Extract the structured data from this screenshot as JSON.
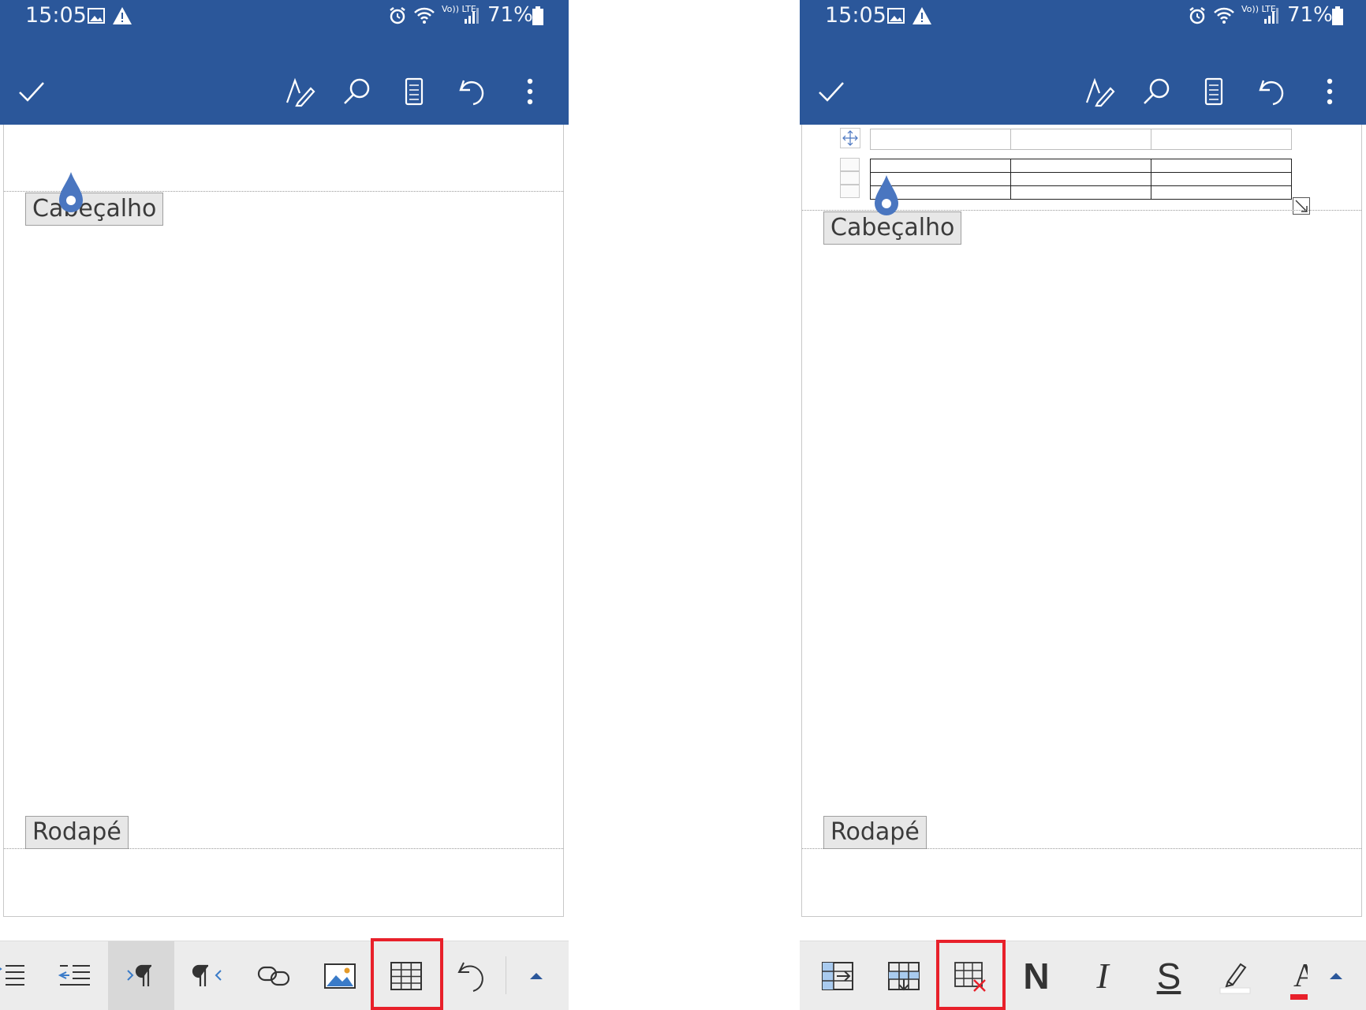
{
  "status_bar": {
    "time": "15:05",
    "network": "Vo)) LTE",
    "battery": "71%"
  },
  "left": {
    "document": {
      "header_label": "Cabeçalho",
      "footer_label": "Rodapé"
    },
    "bottom_toolbar": [
      {
        "name": "bullet-list-icon"
      },
      {
        "name": "decrease-indent-icon"
      },
      {
        "name": "ltr-paragraph-icon",
        "active": true
      },
      {
        "name": "rtl-paragraph-icon"
      },
      {
        "name": "link-icon"
      },
      {
        "name": "picture-icon"
      },
      {
        "name": "table-icon",
        "highlighted": true
      },
      {
        "name": "undo-icon"
      },
      {
        "name": "expand-up-icon"
      }
    ]
  },
  "right": {
    "document": {
      "header_label": "Cabeçalho",
      "footer_label": "Rodapé",
      "table": {
        "rows": 3,
        "cols": 3
      }
    },
    "bottom_toolbar": [
      {
        "name": "insert-column-icon"
      },
      {
        "name": "insert-row-icon"
      },
      {
        "name": "delete-table-icon",
        "highlighted": true
      },
      {
        "name": "bold-icon",
        "glyph": "N"
      },
      {
        "name": "italic-icon",
        "glyph": "I"
      },
      {
        "name": "strikethrough-icon",
        "glyph": "S"
      },
      {
        "name": "highlight-icon"
      },
      {
        "name": "font-color-icon",
        "glyph": "A"
      },
      {
        "name": "expand-up-icon"
      }
    ]
  },
  "colors": {
    "app_bar": "#2b579a",
    "highlight_box": "#e8202a",
    "cursor": "#4a76c0",
    "font_color_swatch": "#e8202a"
  }
}
